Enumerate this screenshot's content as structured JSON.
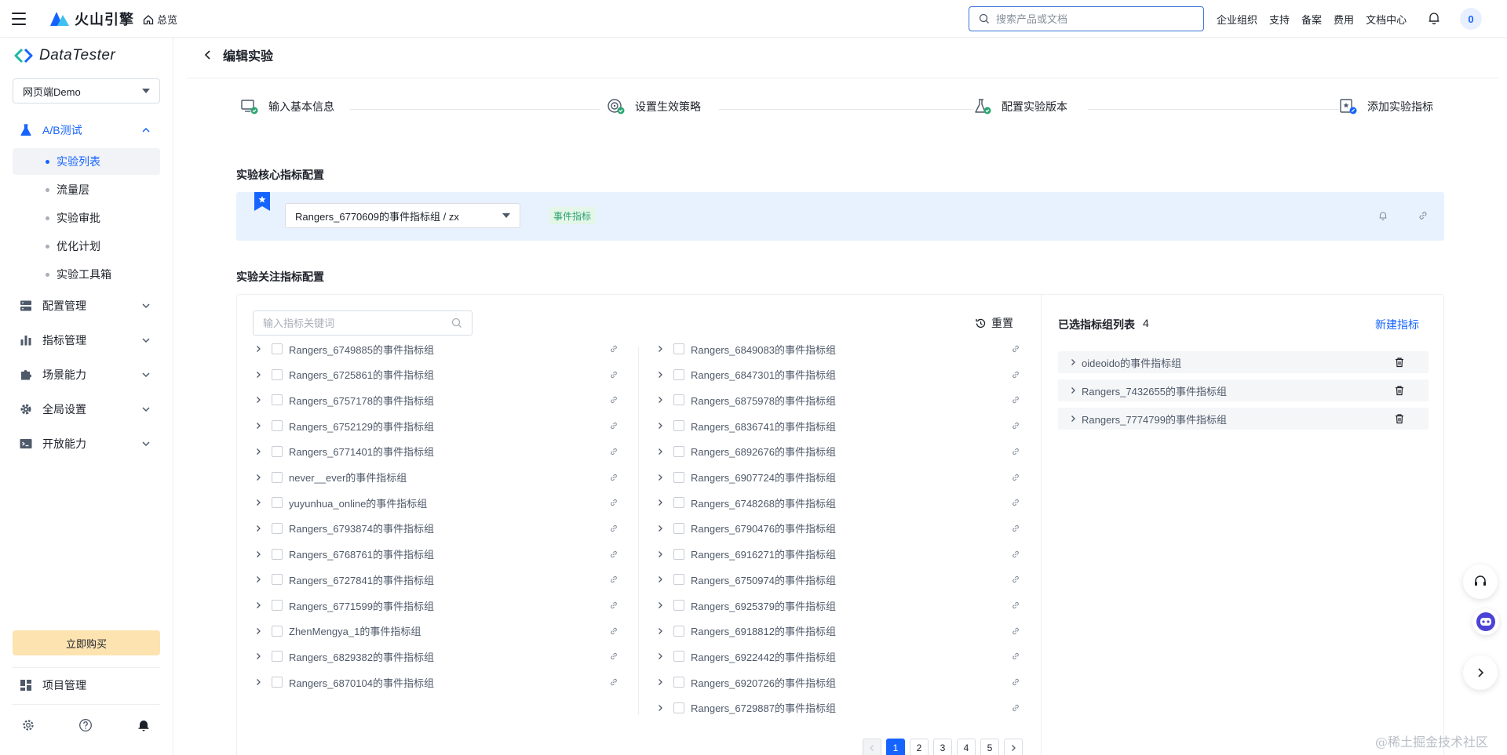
{
  "topbar": {
    "brand": "火山引擎",
    "home_label": "总览",
    "search_placeholder": "搜索产品或文档",
    "nav": [
      "企业组织",
      "支持",
      "备案",
      "费用",
      "文档中心"
    ],
    "avatar": "0"
  },
  "sidebar": {
    "logo": "DataTester",
    "project_select": "网页端Demo",
    "groups": {
      "ab": "A/B测试",
      "config": "配置管理",
      "metrics": "指标管理",
      "scene": "场景能力",
      "global": "全局设置",
      "open": "开放能力"
    },
    "sub_items": [
      "实验列表",
      "流量层",
      "实验审批",
      "优化计划",
      "实验工具箱"
    ],
    "buy_button": "立即购买",
    "project_manage": "项目管理"
  },
  "page": {
    "title": "编辑实验",
    "steps": [
      "输入基本信息",
      "设置生效策略",
      "配置实验版本",
      "添加实验指标"
    ]
  },
  "core": {
    "title": "实验核心指标配置",
    "selected": "Rangers_6770609的事件指标组 / zx",
    "tag": "事件指标"
  },
  "focus": {
    "title": "实验关注指标配置",
    "search_placeholder": "输入指标关键词",
    "reset": "重置",
    "left_column": [
      "Rangers_6749885的事件指标组",
      "Rangers_6725861的事件指标组",
      "Rangers_6757178的事件指标组",
      "Rangers_6752129的事件指标组",
      "Rangers_6771401的事件指标组",
      "never__ever的事件指标组",
      "yuyunhua_online的事件指标组",
      "Rangers_6793874的事件指标组",
      "Rangers_6768761的事件指标组",
      "Rangers_6727841的事件指标组",
      "Rangers_6771599的事件指标组",
      "ZhenMengya_1的事件指标组",
      "Rangers_6829382的事件指标组",
      "Rangers_6870104的事件指标组"
    ],
    "right_column": [
      "Rangers_6849083的事件指标组",
      "Rangers_6847301的事件指标组",
      "Rangers_6875978的事件指标组",
      "Rangers_6836741的事件指标组",
      "Rangers_6892676的事件指标组",
      "Rangers_6907724的事件指标组",
      "Rangers_6748268的事件指标组",
      "Rangers_6790476的事件指标组",
      "Rangers_6916271的事件指标组",
      "Rangers_6750974的事件指标组",
      "Rangers_6925379的事件指标组",
      "Rangers_6918812的事件指标组",
      "Rangers_6922442的事件指标组",
      "Rangers_6920726的事件指标组",
      "Rangers_6729887的事件指标组"
    ],
    "pages": [
      "1",
      "2",
      "3",
      "4",
      "5"
    ],
    "current_page": "1"
  },
  "selected_list": {
    "title": "已选指标组列表",
    "count": "4",
    "new_button": "新建指标",
    "items": [
      "oideoido的事件指标组",
      "Rangers_7432655的事件指标组",
      "Rangers_7774799的事件指标组"
    ]
  },
  "watermark": "@稀土掘金技术社区",
  "colors": {
    "accent": "#1664ff",
    "core_panel_bg": "#e8f2ff",
    "buy_bg": "#fde3b0",
    "tag_green": "#2ba471"
  }
}
